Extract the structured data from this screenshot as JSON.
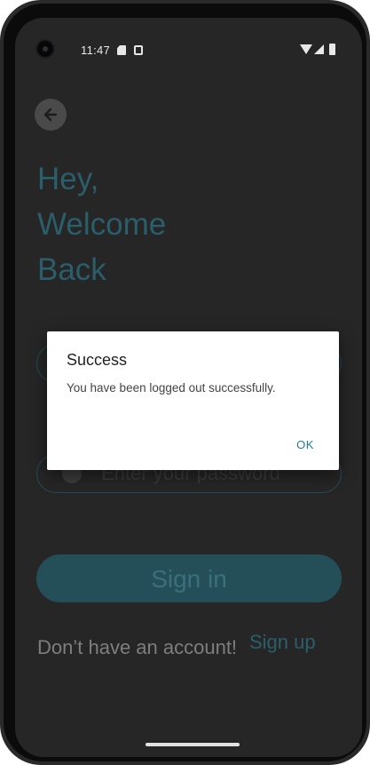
{
  "status_bar": {
    "time": "11:47"
  },
  "login": {
    "headline": [
      "Hey,",
      "Welcome",
      "Back"
    ],
    "password_placeholder": "Enter your password",
    "sign_in_label": "Sign in",
    "no_account_text": "Don’t have an account!",
    "sign_up_label": "Sign up"
  },
  "dialog": {
    "title": "Success",
    "message": "You have been logged out successfully.",
    "ok_label": "OK"
  },
  "icons": {
    "back": "arrow-left-icon",
    "email": "email-icon",
    "password": "lock-icon",
    "wifi": "wifi-icon",
    "signal": "cellular-signal-icon",
    "battery": "battery-icon"
  },
  "colors": {
    "background": "#262626",
    "accent": "#2a5e6a",
    "button": "#244f59",
    "dialog_button": "#1f7f89"
  }
}
